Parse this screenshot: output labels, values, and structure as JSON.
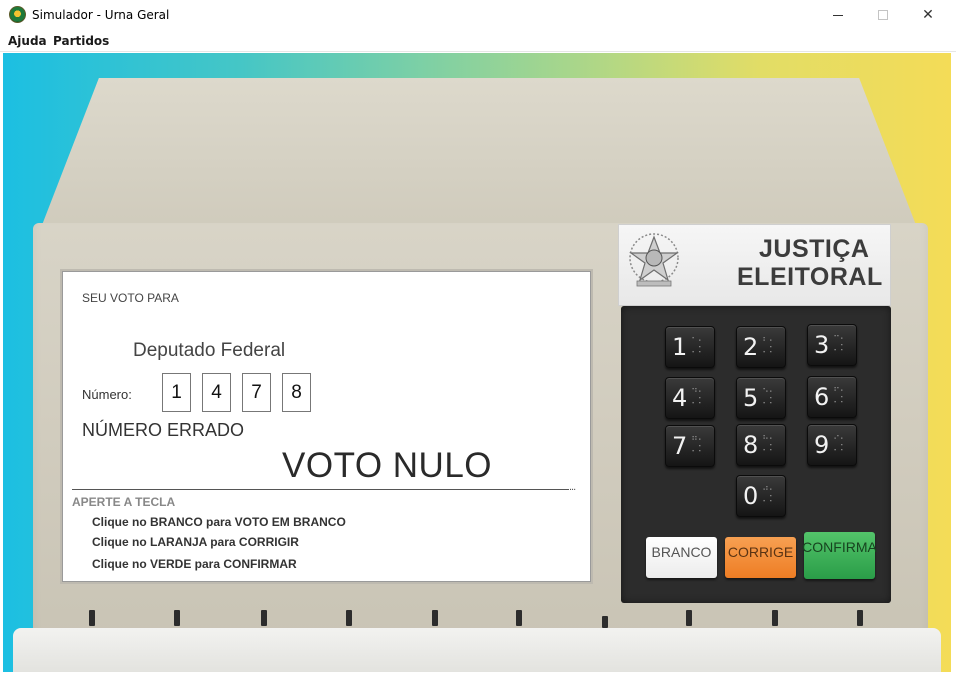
{
  "window": {
    "title": "Simulador - Urna Geral",
    "icon": "brazil-coat-of-arms-icon",
    "controls": {
      "minimize": "minimize-icon",
      "maximize": "maximize-icon",
      "close": "✕"
    }
  },
  "menu": {
    "items": [
      "Ajuda",
      "Partidos"
    ]
  },
  "colors": {
    "gradient_left": "#1cbfe2",
    "gradient_right": "#f4dc57",
    "branco": "#ffffff",
    "corrige": "#ee7d24",
    "confirma": "#2a9d48"
  },
  "screen": {
    "header": "SEU VOTO PARA",
    "office": "Deputado Federal",
    "number_label": "Número:",
    "digits": [
      "1",
      "4",
      "7",
      "8"
    ],
    "status": "NÚMERO ERRADO",
    "vote_result": "VOTO NULO",
    "dots": "...",
    "instructions_title": "APERTE A TECLA",
    "instructions": [
      "Clique no BRANCO para VOTO EM BRANCO",
      "Clique no LARANJA para CORRIGIR",
      "Clique no VERDE para CONFIRMAR"
    ]
  },
  "brand": {
    "line1": "JUSTIÇA",
    "line2": "ELEITORAL",
    "emblem": "coat-of-arms-icon"
  },
  "keypad": {
    "keys": [
      "1",
      "2",
      "3",
      "4",
      "5",
      "6",
      "7",
      "8",
      "9",
      "0"
    ],
    "branco": "BRANCO",
    "corrige": "CORRIGE",
    "confirma": "CONFIRMA"
  }
}
